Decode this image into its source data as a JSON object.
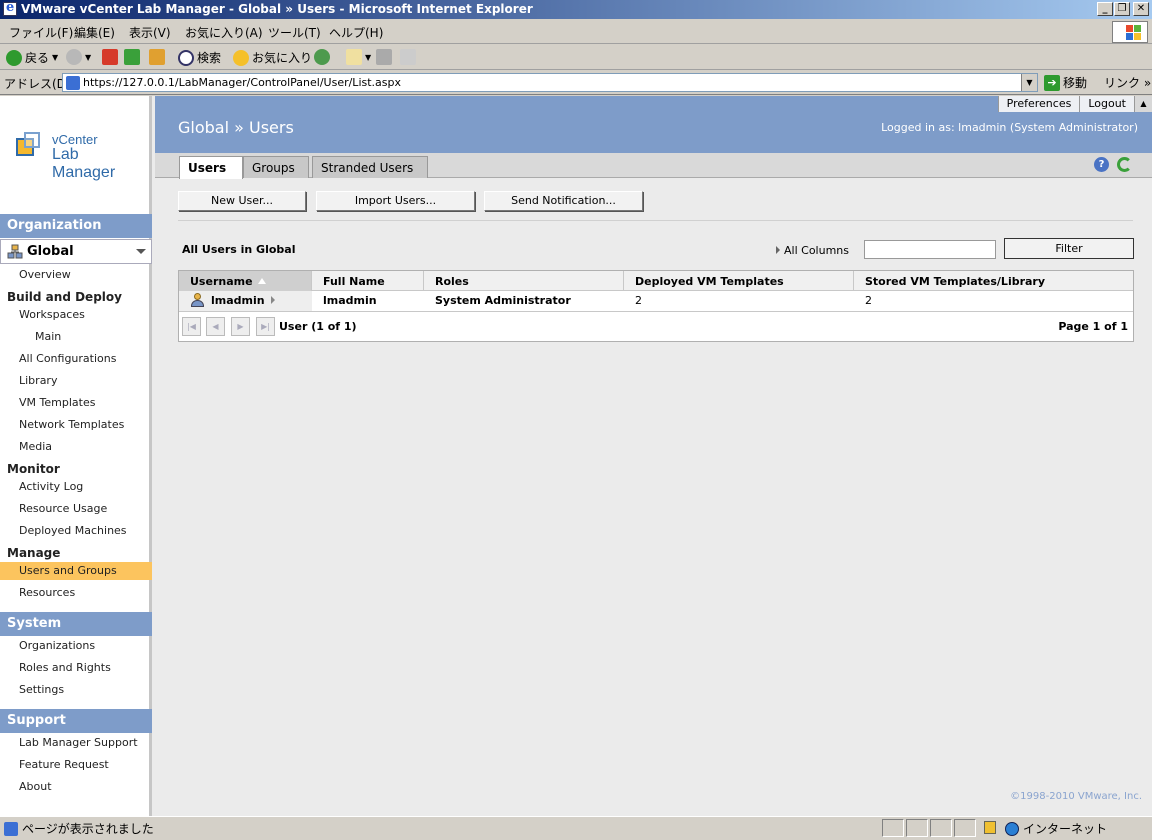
{
  "window": {
    "title": "VMware vCenter Lab Manager - Global » Users - Microsoft Internet Explorer",
    "controls": [
      "_",
      "❐",
      "✕"
    ]
  },
  "menubar": {
    "items": [
      "ファイル(F)",
      "編集(E)",
      "表示(V)",
      "お気に入り(A)",
      "ツール(T)",
      "ヘルプ(H)"
    ]
  },
  "toolbar": {
    "back": "戻る",
    "search": "検索",
    "favorites": "お気に入り"
  },
  "addressbar": {
    "label": "アドレス(D)",
    "url": "https://127.0.0.1/LabManager/ControlPanel/User/List.aspx",
    "go": "移動",
    "links": "リンク »"
  },
  "brand": {
    "line1": "vCenter",
    "line2": "Lab Manager"
  },
  "sidebar": {
    "organization_header": "Organization",
    "org_selected": "Global",
    "overview": "Overview",
    "build_deploy": "Build and Deploy",
    "workspaces": "Workspaces",
    "main": "Main",
    "all_configurations": "All Configurations",
    "library": "Library",
    "vm_templates": "VM Templates",
    "network_templates": "Network Templates",
    "media": "Media",
    "monitor": "Monitor",
    "activity_log": "Activity Log",
    "resource_usage": "Resource Usage",
    "deployed_machines": "Deployed Machines",
    "manage": "Manage",
    "users_groups": "Users and Groups",
    "resources": "Resources",
    "system_header": "System",
    "organizations": "Organizations",
    "roles_rights": "Roles and Rights",
    "settings": "Settings",
    "support_header": "Support",
    "lm_support": "Lab Manager Support",
    "feature_request": "Feature Request",
    "about": "About"
  },
  "header": {
    "title": "Global » Users",
    "logged_in": "Logged in as: lmadmin (System Administrator)",
    "preferences": "Preferences",
    "logout": "Logout"
  },
  "tabs": {
    "users": "Users",
    "groups": "Groups",
    "stranded": "Stranded Users"
  },
  "actions": {
    "new_user": "New User...",
    "import_users": "Import Users...",
    "send_notification": "Send Notification..."
  },
  "list": {
    "title": "All Users in Global",
    "all_columns": "All Columns",
    "filter_value": "",
    "filter_button": "Filter",
    "columns": [
      "Username",
      "Full Name",
      "Roles",
      "Deployed VM Templates",
      "Stored VM Templates/Library"
    ],
    "rows": [
      {
        "username": "lmadmin",
        "full_name": "lmadmin",
        "roles": "System Administrator",
        "deployed": "2",
        "stored": "2"
      }
    ],
    "record_summary": "User (1 of 1)",
    "page_summary": "Page 1 of 1"
  },
  "footer": {
    "copyright": "©1998-2010 VMware, Inc."
  },
  "statusbar": {
    "text": "ページが表示されました",
    "zone": "インターネット"
  }
}
